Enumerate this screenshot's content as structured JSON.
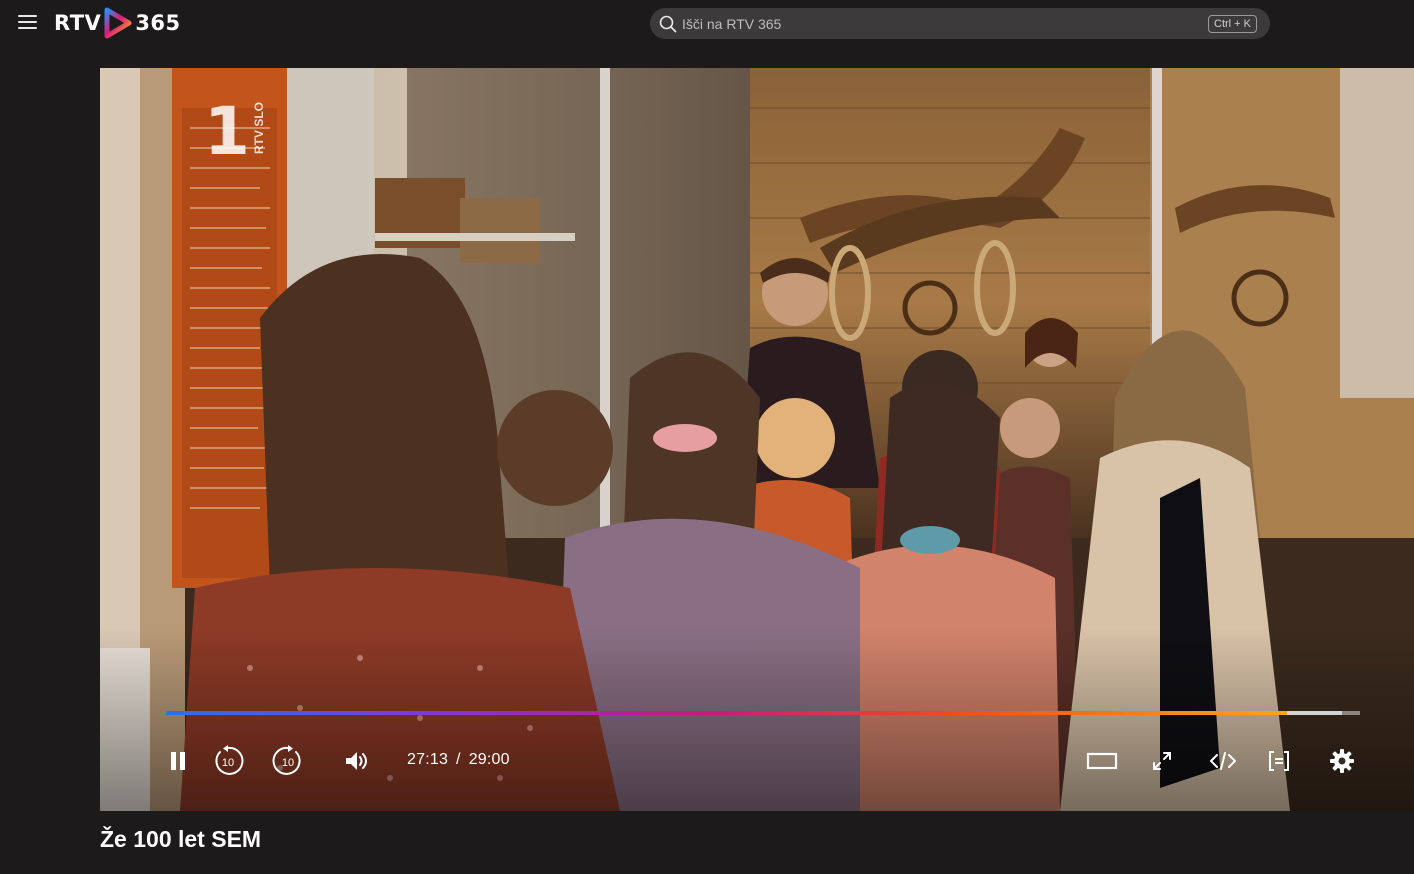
{
  "header": {
    "logo_left": "RTV",
    "logo_right": "365",
    "search_placeholder": "Išči na RTV 365",
    "search_shortcut": "Ctrl + K"
  },
  "player": {
    "channel_number": "1",
    "channel_name": "RTV SLO",
    "current_time": "27:13",
    "time_separator": "/",
    "duration": "29:00",
    "progress_fraction": 0.9385,
    "buffered_fraction": 0.985,
    "rewind_seconds": "10",
    "forward_seconds": "10"
  },
  "video": {
    "title": "Že 100 let SEM"
  },
  "colors": {
    "background": "#1c1a1b",
    "search_bg": "#3c3a3b",
    "accent_start": "#2b6ff2",
    "accent_end": "#f9a51c"
  },
  "icons": {
    "menu": "hamburger-menu-icon",
    "search": "search-icon",
    "pause": "pause-icon",
    "rewind": "rewind-10-icon",
    "forward": "forward-10-icon",
    "volume": "volume-icon",
    "theater": "theater-mode-icon",
    "fullscreen": "fullscreen-icon",
    "embed": "embed-code-icon",
    "subtitles": "subtitles-icon",
    "settings": "settings-gear-icon"
  }
}
